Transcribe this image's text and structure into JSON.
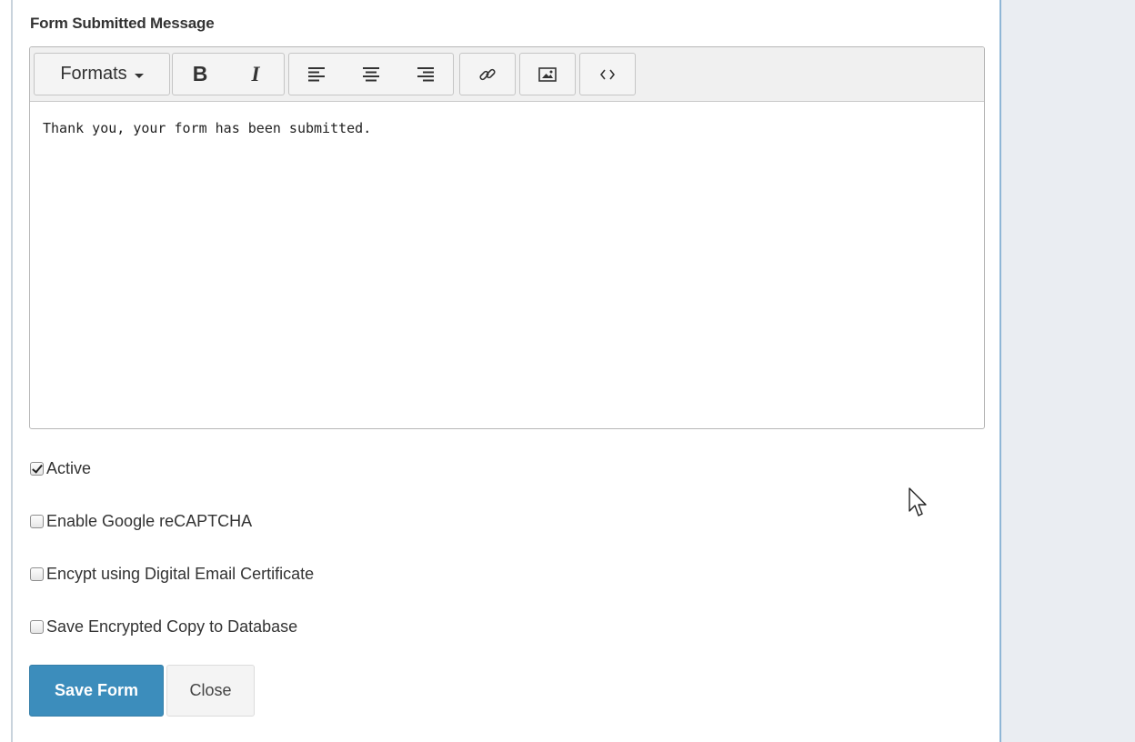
{
  "form": {
    "section_label": "Form Submitted Message",
    "editor": {
      "toolbar": {
        "formats_label": "Formats",
        "bold_label": "B",
        "italic_label": "I",
        "icons": [
          "align-left-icon",
          "align-center-icon",
          "align-right-icon",
          "link-icon",
          "image-icon",
          "code-icon"
        ]
      },
      "content": "Thank you, your form has been submitted."
    },
    "options": [
      {
        "label": "Active",
        "checked": true
      },
      {
        "label": "Enable Google reCAPTCHA",
        "checked": false
      },
      {
        "label": "Encypt using Digital Email Certificate",
        "checked": false
      },
      {
        "label": "Save Encrypted Copy to Database",
        "checked": false
      }
    ],
    "buttons": {
      "save_label": "Save Form",
      "close_label": "Close"
    }
  },
  "colors": {
    "primary": "#3c8dbc",
    "side_panel": "#eaedf2",
    "panel_border": "#8fb6d6"
  }
}
